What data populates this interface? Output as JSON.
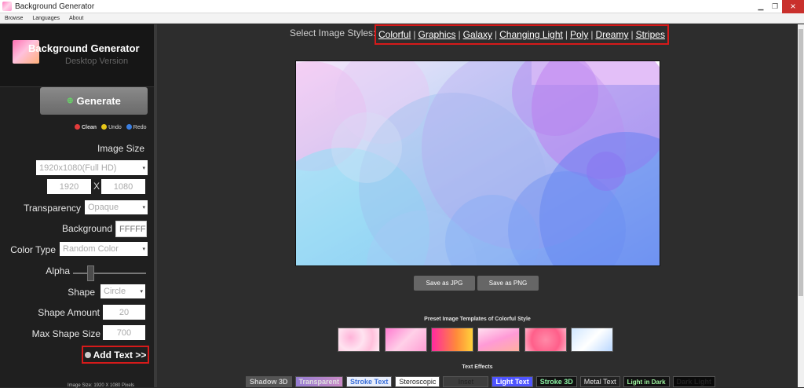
{
  "window": {
    "title": "Background Generator"
  },
  "menu": [
    "Browse",
    "Languages",
    "About"
  ],
  "sidebar": {
    "brand_title": "Background Generator",
    "brand_subtitle": "Desktop Version",
    "generate_label": "Generate",
    "history": {
      "clean": "Clean",
      "undo": "Undo",
      "redo": "Redo"
    },
    "image_size_label": "Image Size",
    "image_size_value": "1920x1080(Full HD)",
    "width_value": "1920",
    "x_sep": "X",
    "height_value": "1080",
    "transparency_label": "Transparency",
    "transparency_value": "Opaque",
    "background_label": "Background",
    "background_value": "FFFFF",
    "color_type_label": "Color Type",
    "color_type_value": "Random Color",
    "alpha_label": "Alpha",
    "alpha_value": 0.2,
    "shape_label": "Shape",
    "shape_value": "Circle",
    "shape_amount_label": "Shape Amount",
    "shape_amount_value": "20",
    "max_shape_label": "Max Shape Size",
    "max_shape_value": "700",
    "add_text_label": "Add Text >>",
    "size_info": "Image Size: 1920 X 1080 Pixels"
  },
  "main": {
    "styles_label": "Select Image Styles:",
    "styles": [
      "Colorful",
      "Graphics",
      "Galaxy",
      "Changing Light",
      "Poly",
      "Dreamy",
      "Stripes"
    ],
    "save_jpg": "Save as JPG",
    "save_png": "Save as PNG",
    "templates_title": "Preset Image Templates of Colorful Style",
    "effects_title": "Text Effects",
    "effects": [
      "Shadow 3D",
      "Transparent",
      "Stroke Text",
      "Steroscopic",
      "Inset",
      "Light Text",
      "Stroke 3D",
      "Metal Text",
      "Light in Dark",
      "Dark Light"
    ]
  },
  "colors": {
    "accent_red": "#d61a1a",
    "sidebar_bg": "#1f1f1f",
    "main_bg": "#2d2d2d"
  }
}
